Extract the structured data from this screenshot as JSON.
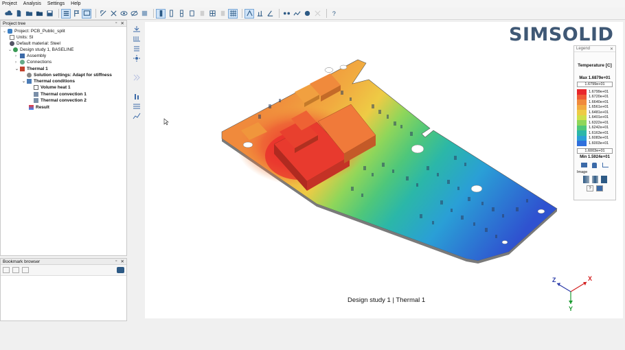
{
  "menu": [
    "Project",
    "Analysis",
    "Settings",
    "Help"
  ],
  "project_tree": {
    "title": "Project tree",
    "items": [
      {
        "label": "Project: PCB_Public_split",
        "bold": false
      },
      {
        "label": "Units: SI",
        "bold": false
      },
      {
        "label": "Default material: Steel",
        "bold": false
      },
      {
        "label": "Design study 1, BASELINE",
        "bold": false
      },
      {
        "label": "Assembly",
        "bold": false
      },
      {
        "label": "Connections",
        "bold": false
      },
      {
        "label": "Thermal 1",
        "bold": true
      },
      {
        "label": "Solution settings: Adapt for stiffness",
        "bold": true
      },
      {
        "label": "Thermal conditions",
        "bold": true
      },
      {
        "label": "Volume heat 1",
        "bold": true
      },
      {
        "label": "Thermal convection 1",
        "bold": true
      },
      {
        "label": "Thermal convection 2",
        "bold": true
      },
      {
        "label": "Result",
        "bold": true
      }
    ]
  },
  "bookmark_browser": {
    "title": "Bookmark browser"
  },
  "logo": "SIMSOLID",
  "legend": {
    "header": "Legend",
    "title": "Temperature [C]",
    "max_label": "Max  1.6879e+01",
    "top_value": "1.6799e+01",
    "entries": [
      {
        "value": "1.6799e+01",
        "color": "#e8262b"
      },
      {
        "value": "1.6720e+01",
        "color": "#ee5a34"
      },
      {
        "value": "1.6640e+01",
        "color": "#f08a3c"
      },
      {
        "value": "1.6561e+01",
        "color": "#f1ab40"
      },
      {
        "value": "1.6481e+01",
        "color": "#eecb45"
      },
      {
        "value": "1.6401e+01",
        "color": "#cde04a"
      },
      {
        "value": "1.6322e+01",
        "color": "#8fd65a"
      },
      {
        "value": "1.6242e+01",
        "color": "#4fc77a"
      },
      {
        "value": "1.6163e+01",
        "color": "#2bb7a8"
      },
      {
        "value": "1.6083e+01",
        "color": "#2a9fd6"
      },
      {
        "value": "1.6003e+01",
        "color": "#2f6fdc"
      }
    ],
    "bottom_value": "1.6003e+01",
    "min_label": "Min  1.5924e+01",
    "image_label": "Image"
  },
  "caption": "Design study 1 | Thermal 1",
  "axes": {
    "x": "X",
    "y": "Y",
    "z": "Z"
  }
}
